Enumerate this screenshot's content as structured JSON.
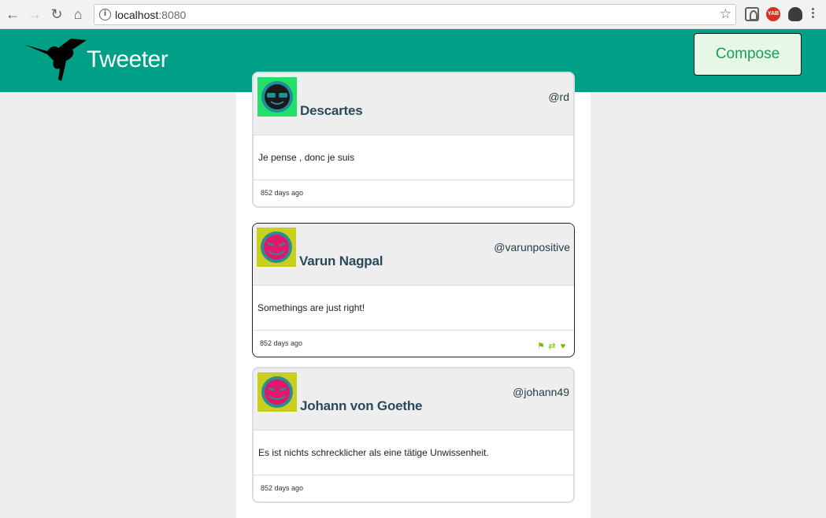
{
  "browser": {
    "url_host": "localhost",
    "url_port": ":8080",
    "ext_yab_label": "YAB"
  },
  "app": {
    "title": "Tweeter",
    "compose_label": "Compose",
    "brand_color": "#00a087"
  },
  "tweets": [
    {
      "name": "Descartes",
      "handle": "@rd",
      "text": "Je pense , donc je suis",
      "time": "852 days ago"
    },
    {
      "name": "Varun Nagpal",
      "handle": "@varunpositive",
      "text": "Somethings are just right!",
      "time": "852 days ago"
    },
    {
      "name": "Johann von Goethe",
      "handle": "@johann49",
      "text": "Es ist nichts schrecklicher als eine tätige Unwissenheit.",
      "time": "852 days ago"
    }
  ]
}
